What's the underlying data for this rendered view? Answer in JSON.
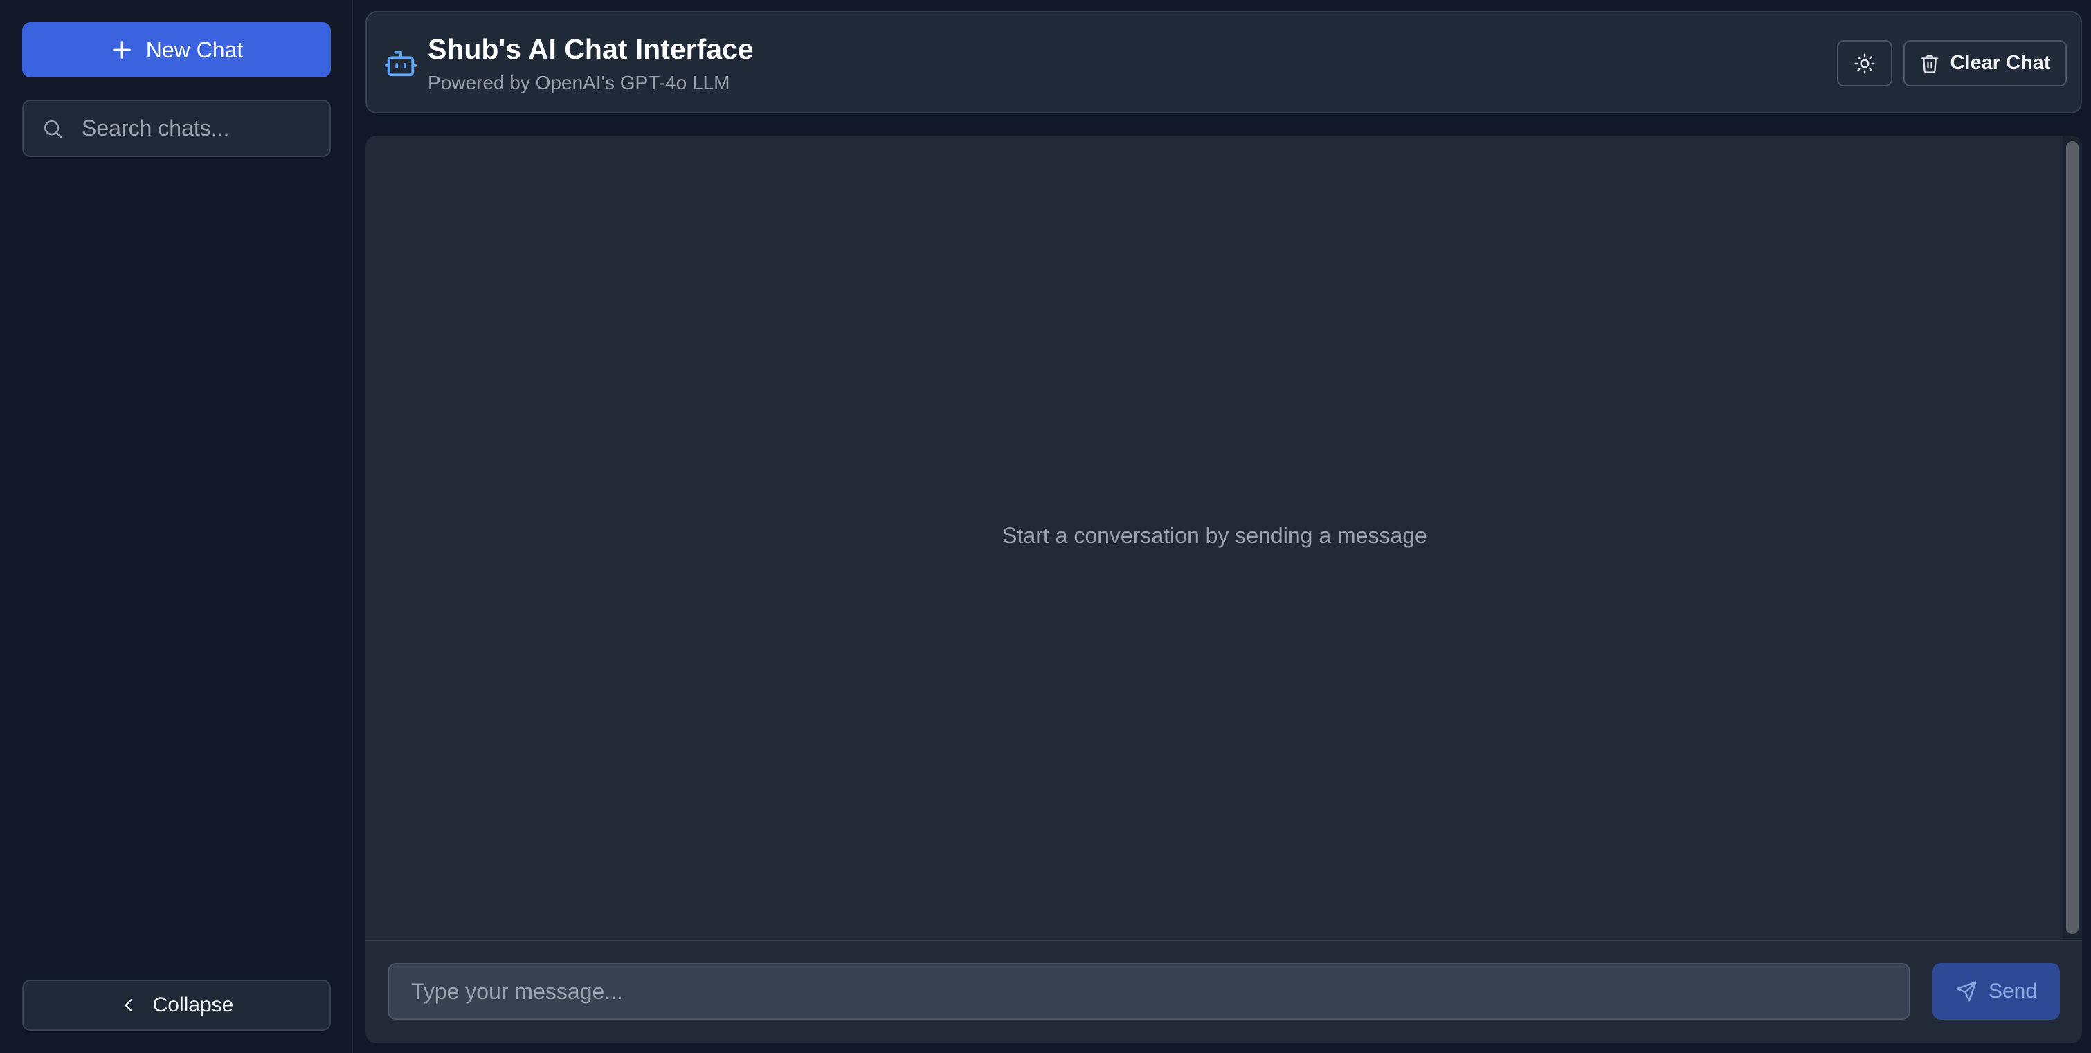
{
  "sidebar": {
    "new_chat_label": "New Chat",
    "search_placeholder": "Search chats...",
    "collapse_label": "Collapse"
  },
  "header": {
    "title": "Shub's AI Chat Interface",
    "subtitle": "Powered by OpenAI's GPT-4o LLM",
    "clear_label": "Clear Chat"
  },
  "chat": {
    "empty_message": "Start a conversation by sending a message",
    "input_placeholder": "Type your message...",
    "send_label": "Send"
  },
  "icons": {
    "new_chat": "plus-icon",
    "search": "search-icon",
    "collapse": "chevron-left-icon",
    "brand": "bot-icon",
    "theme": "sun-icon",
    "clear": "trash-icon",
    "send": "send-icon"
  },
  "colors": {
    "accent": "#3b63e0",
    "send_button": "#2e4a96",
    "background": "#111827",
    "panel": "#222a38"
  }
}
